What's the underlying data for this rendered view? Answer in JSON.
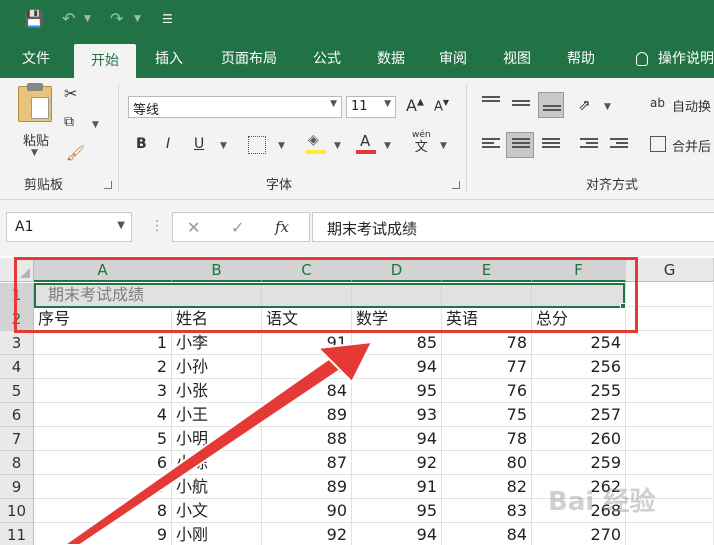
{
  "tabs": [
    "文件",
    "开始",
    "插入",
    "页面布局",
    "公式",
    "数据",
    "审阅",
    "视图",
    "帮助",
    "操作说明"
  ],
  "active_tab": "开始",
  "ribbon": {
    "clipboard_group": "剪贴板",
    "paste_label": "粘贴",
    "font_group": "字体",
    "font_name": "等线",
    "font_size": "11",
    "bold": "B",
    "italic": "I",
    "underline": "U",
    "grow_font": "A",
    "shrink_font": "A",
    "phonetic_top": "wén",
    "phonetic_bottom": "文",
    "alignment_group": "对齐方式",
    "wrap_text": "自动换",
    "merge_center": "合并后"
  },
  "formula_bar": {
    "name_box": "A1",
    "cancel": "✕",
    "enter": "✓",
    "fx": "fx",
    "content": "期末考试成绩"
  },
  "columns": [
    "A",
    "B",
    "C",
    "D",
    "E",
    "F",
    "G"
  ],
  "rows": [
    {
      "n": "1",
      "cells": [
        "期末考试成绩",
        "",
        "",
        "",
        "",
        ""
      ]
    },
    {
      "n": "2",
      "cells": [
        "序号",
        "姓名",
        "语文",
        "数学",
        "英语",
        "总分"
      ]
    },
    {
      "n": "3",
      "cells": [
        "1",
        "小李",
        "91",
        "85",
        "78",
        "254"
      ]
    },
    {
      "n": "4",
      "cells": [
        "2",
        "小孙",
        "85",
        "94",
        "77",
        "256"
      ]
    },
    {
      "n": "5",
      "cells": [
        "3",
        "小张",
        "84",
        "95",
        "76",
        "255"
      ]
    },
    {
      "n": "6",
      "cells": [
        "4",
        "小王",
        "89",
        "93",
        "75",
        "257"
      ]
    },
    {
      "n": "7",
      "cells": [
        "5",
        "小明",
        "88",
        "94",
        "78",
        "260"
      ]
    },
    {
      "n": "8",
      "cells": [
        "6",
        "小陈",
        "87",
        "92",
        "80",
        "259"
      ]
    },
    {
      "n": "9",
      "cells": [
        "7",
        "小航",
        "89",
        "91",
        "82",
        "262"
      ]
    },
    {
      "n": "10",
      "cells": [
        "8",
        "小文",
        "90",
        "95",
        "83",
        "268"
      ]
    },
    {
      "n": "11",
      "cells": [
        "9",
        "小刚",
        "92",
        "94",
        "84",
        "270"
      ]
    }
  ],
  "watermark": "Bai 经验",
  "colors": {
    "accent": "#217346",
    "highlight": "#e53935"
  }
}
